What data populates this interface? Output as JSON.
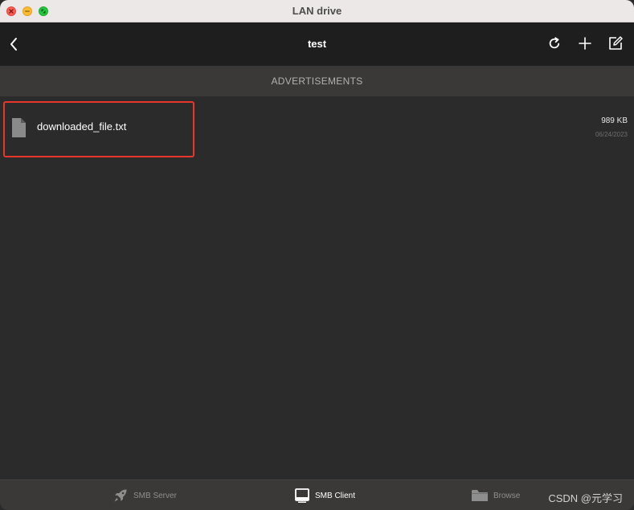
{
  "window": {
    "title": "LAN drive"
  },
  "navbar": {
    "title": "test"
  },
  "ad_bar": {
    "label": "ADVERTISEMENTS"
  },
  "files": [
    {
      "name": "downloaded_file.txt",
      "size": "989 KB",
      "date": "06/24/2023",
      "icon": "document-icon"
    }
  ],
  "tabbar": {
    "tabs": [
      {
        "label": "SMB Server",
        "icon": "rocket-icon",
        "active": false
      },
      {
        "label": "SMB Client",
        "icon": "monitor-icon",
        "active": true
      },
      {
        "label": "Browse",
        "icon": "folder-icon",
        "active": false
      }
    ]
  },
  "watermark": "CSDN @元学习",
  "colors": {
    "highlight": "#e8362a",
    "background": "#2b2b2c",
    "navbar": "#1e1e1f"
  }
}
